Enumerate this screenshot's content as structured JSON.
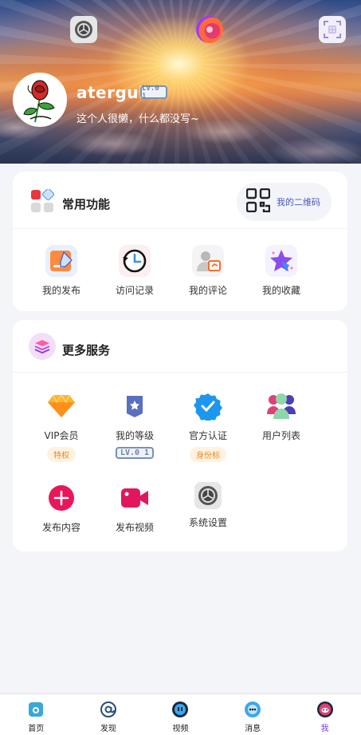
{
  "profile": {
    "username": "atergul",
    "level_badge": "LV.0 1",
    "bio": "这个人很懒，什么都没写~"
  },
  "header_icons": [
    "settings-icon",
    "skin-icon",
    "scan-icon"
  ],
  "common": {
    "title": "常用功能",
    "qr_label": "我的二维码",
    "items": [
      {
        "label": "我的发布",
        "icon": "publish-icon"
      },
      {
        "label": "访问记录",
        "icon": "history-icon"
      },
      {
        "label": "我的评论",
        "icon": "comment-icon"
      },
      {
        "label": "我的收藏",
        "icon": "star-icon"
      }
    ]
  },
  "services": {
    "title": "更多服务",
    "items": [
      {
        "label": "VIP会员",
        "icon": "vip-diamond-icon",
        "tag": "特权"
      },
      {
        "label": "我的等级",
        "icon": "level-icon",
        "tag": "LV.0 1"
      },
      {
        "label": "官方认证",
        "icon": "verified-icon",
        "tag": "身份标"
      },
      {
        "label": "用户列表",
        "icon": "users-icon"
      },
      {
        "label": "发布内容",
        "icon": "plus-icon"
      },
      {
        "label": "发布视频",
        "icon": "video-icon"
      },
      {
        "label": "系统设置",
        "icon": "settings-icon"
      }
    ]
  },
  "nav": {
    "items": [
      {
        "label": "首页",
        "icon": "home-icon"
      },
      {
        "label": "发现",
        "icon": "at-icon"
      },
      {
        "label": "视频",
        "icon": "video-face-icon"
      },
      {
        "label": "消息",
        "icon": "message-icon"
      },
      {
        "label": "我",
        "icon": "me-icon"
      }
    ],
    "active": "我"
  },
  "colors": {
    "accent": "#7b3ff0",
    "link": "#4a58b8",
    "tag_orange": "#e58a2a"
  }
}
